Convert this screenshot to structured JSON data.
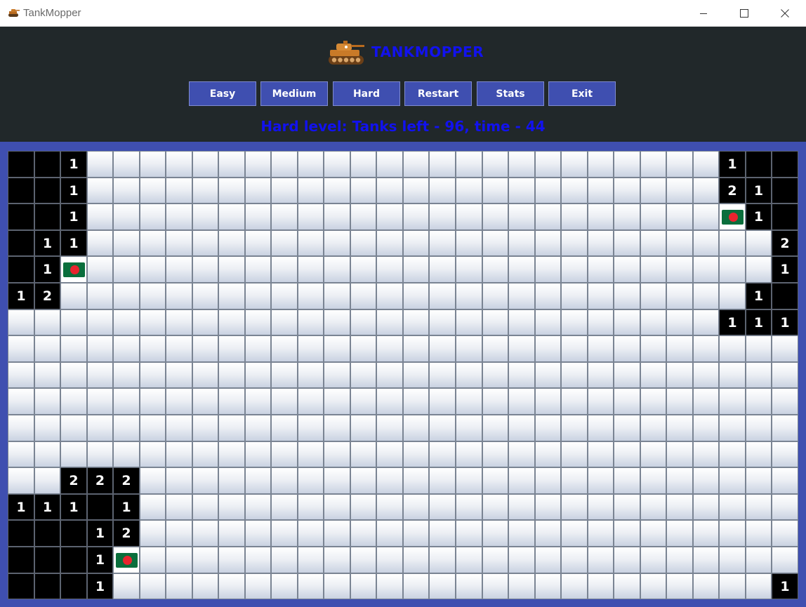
{
  "window": {
    "title": "TankMopper"
  },
  "app": {
    "title": "TANKMOPPER",
    "buttons": [
      {
        "id": "easy",
        "label": "Easy"
      },
      {
        "id": "medium",
        "label": "Medium"
      },
      {
        "id": "hard",
        "label": "Hard"
      },
      {
        "id": "restart",
        "label": "Restart"
      },
      {
        "id": "stats",
        "label": "Stats"
      },
      {
        "id": "exit",
        "label": "Exit"
      }
    ],
    "status": "Hard level: Tanks left - 96, time - 44"
  },
  "colors": {
    "accent": "#3f4fb0",
    "header_bg": "#21282a",
    "title_text": "#1212ee",
    "revealed": "#000000",
    "flag_green": "#0a6e3c",
    "flag_red": "#e8242e"
  },
  "board": {
    "rows": 17,
    "cols": 30,
    "legend": {
      "c": "covered",
      "f": "flagged",
      "o": "revealed empty",
      "1-8": "revealed number"
    },
    "grid": [
      "oo1cccccccccccccccccccccccc1ooo",
      "oo1cccccccccccccccccccccccc21oo",
      "oo1ccccccccccccccccccccccccf1oo",
      "o11cccccccccccccccccccccccccc2oo",
      "o1fcccccccccccccccccccccccccc1oo",
      "12cccccccccccccccccccccccccc1oo",
      "ccccccccccccccccccccccccccc111",
      "cccccccccccccccccccccccccccccc",
      "cccccccccccccccccccccccccccccc",
      "cccccccccccccccccccccccccccccc",
      "cccccccccccccccccccccccccccccc",
      "cccccccccccccccccccccccccccccc",
      "cc222ccccccccccccccccccccccccc",
      "111o1ccccccccccccccccccccccccc",
      "ooo12ccccccccccccccccccccccccc",
      "ooo1fccccccccccccccccccccccccc",
      "ooo1ccccccccccccccccccccccccc1"
    ]
  }
}
